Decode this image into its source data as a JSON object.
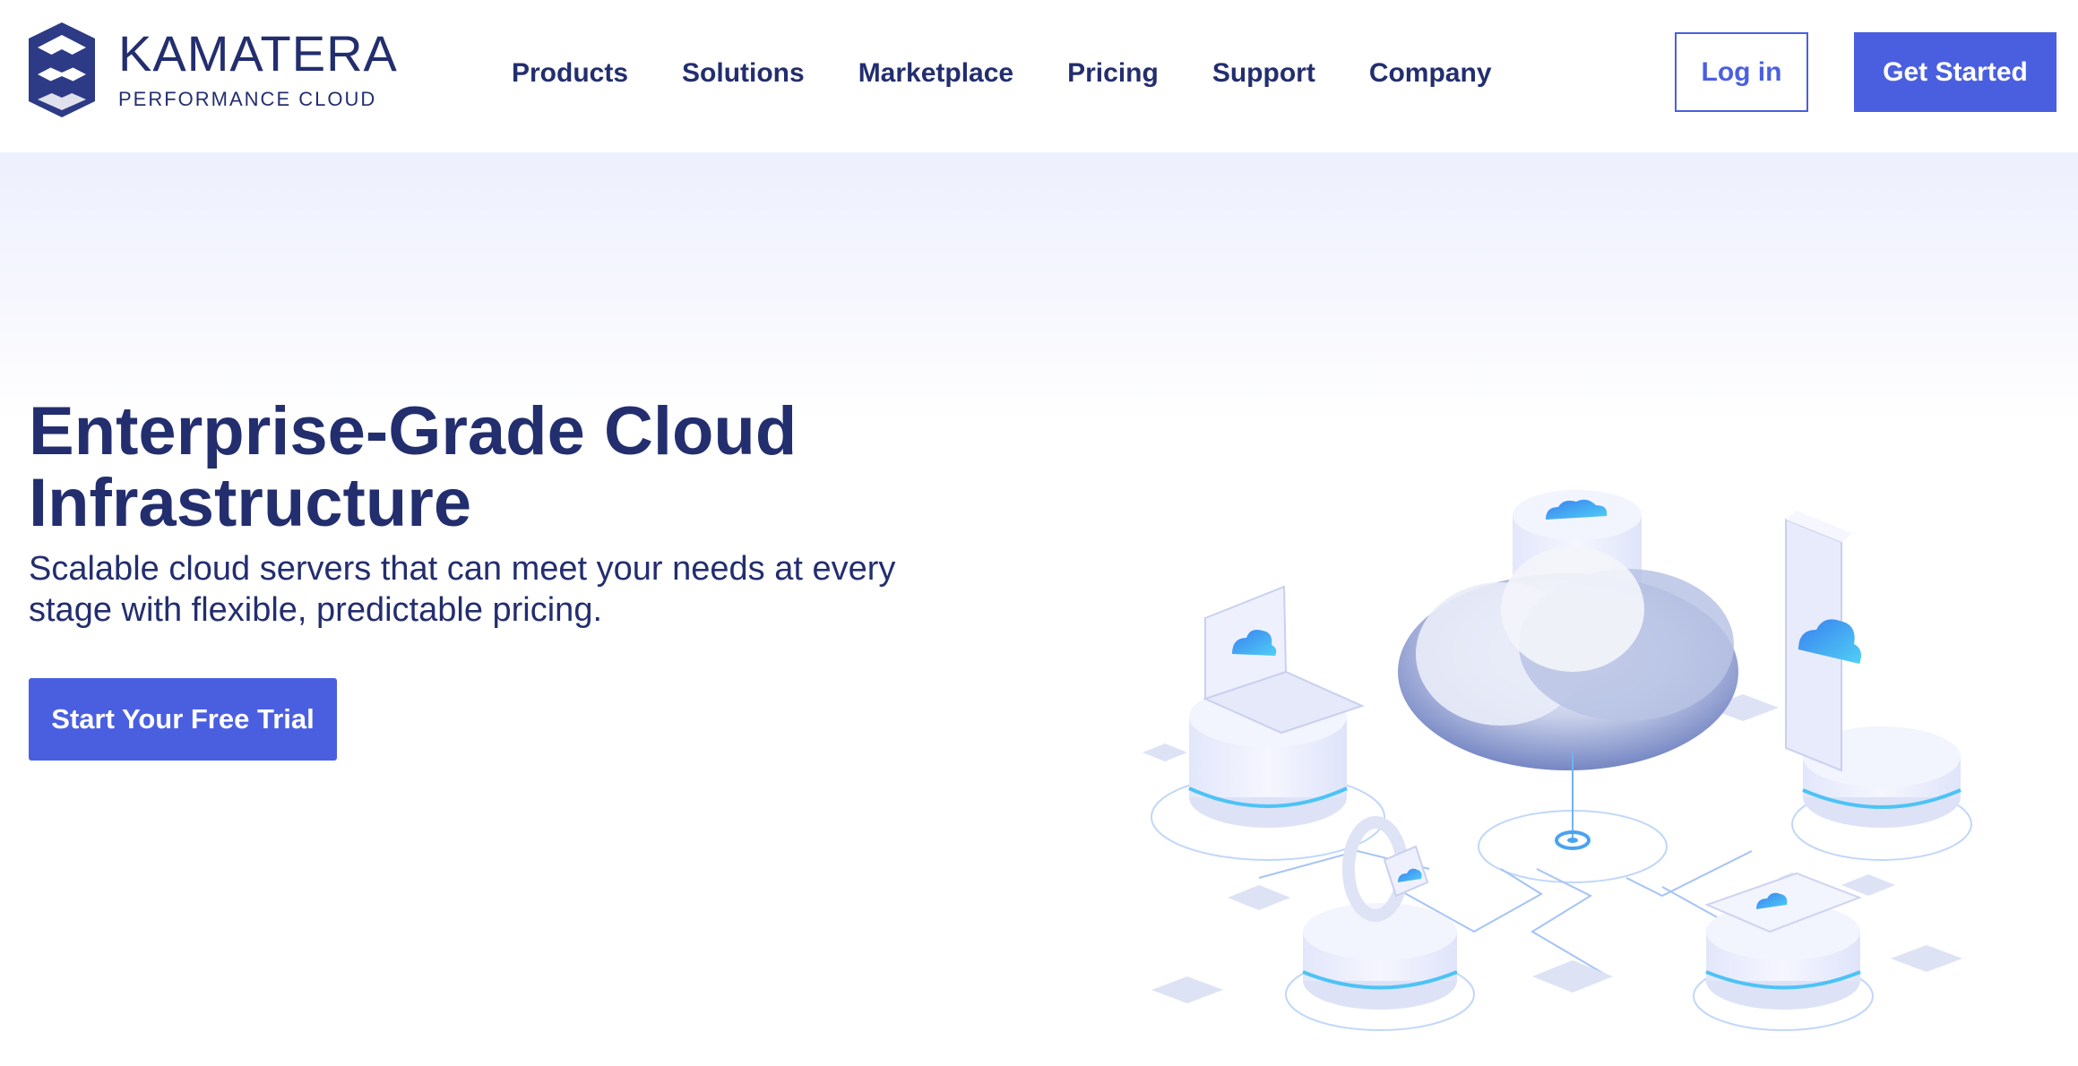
{
  "brand": {
    "name": "KAMATERA",
    "tagline": "PERFORMANCE CLOUD"
  },
  "nav": {
    "items": [
      "Products",
      "Solutions",
      "Marketplace",
      "Pricing",
      "Support",
      "Company"
    ]
  },
  "header": {
    "login_label": "Log in",
    "get_started_label": "Get Started"
  },
  "hero": {
    "title_line1": "Enterprise-Grade Cloud",
    "title_line2": "Infrastructure",
    "subtitle": "Scalable cloud servers that can meet your needs at every stage with flexible, predictable pricing.",
    "cta_label": "Start Your Free Trial"
  },
  "colors": {
    "brand_dark": "#232e6e",
    "accent": "#4a5fe0",
    "hero_bg_top": "#edf0fd",
    "cloud_blue": "#4aa3f0"
  },
  "icons": [
    "kamatera-logo-icon",
    "cloud-icon"
  ]
}
